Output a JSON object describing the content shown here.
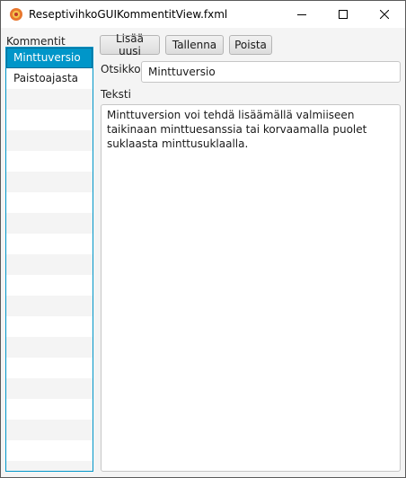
{
  "window": {
    "title": "ReseptivihkoGUIKommentitView.fxml",
    "app_icon": "java-fx-app-icon",
    "controls": [
      "minimize-icon",
      "maximize-icon",
      "close-icon"
    ]
  },
  "sidebar": {
    "label": "Kommentit",
    "items": [
      {
        "label": "Minttuversio",
        "selected": true
      },
      {
        "label": "Paistoajasta",
        "selected": false
      }
    ],
    "accent": "#0096c9"
  },
  "toolbar": {
    "add_label": "Lisää uusi",
    "save_label": "Tallenna",
    "delete_label": "Poista"
  },
  "form": {
    "title_label": "Otsikko",
    "title_value": "Minttuversio",
    "text_label": "Teksti",
    "text_value": "Minttuversion voi tehdä lisäämällä valmiiseen taikinaan minttuesanssia tai korvaamalla puolet suklaasta minttusuklaalla."
  }
}
